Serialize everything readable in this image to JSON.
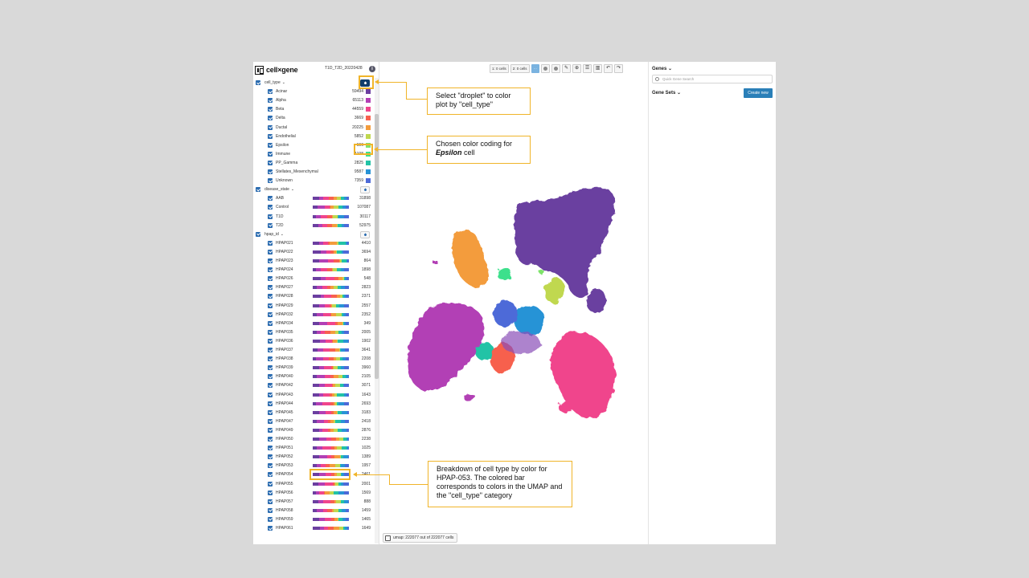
{
  "app": {
    "logo_text": "cell×gene",
    "dataset_name": "T1D_T2D_20220428",
    "info_icon": "i"
  },
  "colors": {
    "accent": "#2b6cb0",
    "annotation": "#f0b429",
    "create_button": "#2a7fb8"
  },
  "categories": {
    "cell_type": {
      "label": "cell_type",
      "items": [
        {
          "label": "Acinar",
          "count": "59494",
          "color": "#6b3fa0"
        },
        {
          "label": "Alpha",
          "count": "65113",
          "color": "#b23fb5"
        },
        {
          "label": "Beta",
          "count": "44559",
          "color": "#f0458c"
        },
        {
          "label": "Delta",
          "count": "3669",
          "color": "#f7604e"
        },
        {
          "label": "Ductal",
          "count": "20225",
          "color": "#f39c3c"
        },
        {
          "label": "Endothelial",
          "count": "5852",
          "color": "#c0d84f"
        },
        {
          "label": "Epsilon",
          "count": "196",
          "color": "#7ee36b"
        },
        {
          "label": "Immune",
          "count": "1198",
          "color": "#3ee08c"
        },
        {
          "label": "PP_Gamma",
          "count": "2825",
          "color": "#22c3a6"
        },
        {
          "label": "Stellates_Mesenchymal",
          "count": "9587",
          "color": "#2893d6"
        },
        {
          "label": "Unknown",
          "count": "7359",
          "color": "#4d6ad8"
        }
      ]
    },
    "disease_state": {
      "label": "disease_state",
      "items": [
        {
          "label": "AAB",
          "count": "31898"
        },
        {
          "label": "Control",
          "count": "107087"
        },
        {
          "label": "T1D",
          "count": "30117"
        },
        {
          "label": "T2D",
          "count": "52975"
        }
      ]
    },
    "hpap_id": {
      "label": "hpap_id",
      "items": [
        {
          "label": "HPAP021",
          "count": "4410"
        },
        {
          "label": "HPAP022",
          "count": "3694"
        },
        {
          "label": "HPAP023",
          "count": "864"
        },
        {
          "label": "HPAP024",
          "count": "1898"
        },
        {
          "label": "HPAP026",
          "count": "548"
        },
        {
          "label": "HPAP027",
          "count": "2823"
        },
        {
          "label": "HPAP028",
          "count": "2371"
        },
        {
          "label": "HPAP029",
          "count": "2557"
        },
        {
          "label": "HPAP032",
          "count": "2352"
        },
        {
          "label": "HPAP034",
          "count": "349"
        },
        {
          "label": "HPAP035",
          "count": "2005"
        },
        {
          "label": "HPAP036",
          "count": "1902"
        },
        {
          "label": "HPAP037",
          "count": "3641"
        },
        {
          "label": "HPAP038",
          "count": "2208"
        },
        {
          "label": "HPAP039",
          "count": "3960"
        },
        {
          "label": "HPAP040",
          "count": "2105"
        },
        {
          "label": "HPAP042",
          "count": "3071"
        },
        {
          "label": "HPAP043",
          "count": "1643"
        },
        {
          "label": "HPAP044",
          "count": "2693"
        },
        {
          "label": "HPAP045",
          "count": "3183"
        },
        {
          "label": "HPAP047",
          "count": "2418"
        },
        {
          "label": "HPAP049",
          "count": "2876"
        },
        {
          "label": "HPAP050",
          "count": "2238"
        },
        {
          "label": "HPAP051",
          "count": "1025"
        },
        {
          "label": "HPAP052",
          "count": "1389"
        },
        {
          "label": "HPAP053",
          "count": "1957"
        },
        {
          "label": "HPAP054",
          "count": "2461"
        },
        {
          "label": "HPAP055",
          "count": "2001"
        },
        {
          "label": "HPAP056",
          "count": "1569"
        },
        {
          "label": "HPAP057",
          "count": "888"
        },
        {
          "label": "HPAP058",
          "count": "1459"
        },
        {
          "label": "HPAP059",
          "count": "1465"
        },
        {
          "label": "HPAP061",
          "count": "1649"
        }
      ]
    }
  },
  "toolbar": {
    "set1": "1: 0 cells",
    "set2": "2: 0 cells",
    "all_button": "···"
  },
  "footer": {
    "embedding_label": "umap: 222077 out of 222077 cells"
  },
  "right_panel": {
    "genes_label": "Genes",
    "search_placeholder": "Quick Gene Search",
    "gene_sets_label": "Gene Sets",
    "create_new_label": "Create new"
  },
  "annotations": {
    "droplet_note": "Select \"droplet\" to color plot by \"cell_type\"",
    "epsilon_note_prefix": "Chosen color coding for",
    "epsilon_note_bold": "Epsilon",
    "epsilon_note_suffix": "cell",
    "breakdown_note": "Breakdown of cell type by color for HPAP-053. The colored bar corresponds to colors in the UMAP and the \"cell_type\" category"
  }
}
